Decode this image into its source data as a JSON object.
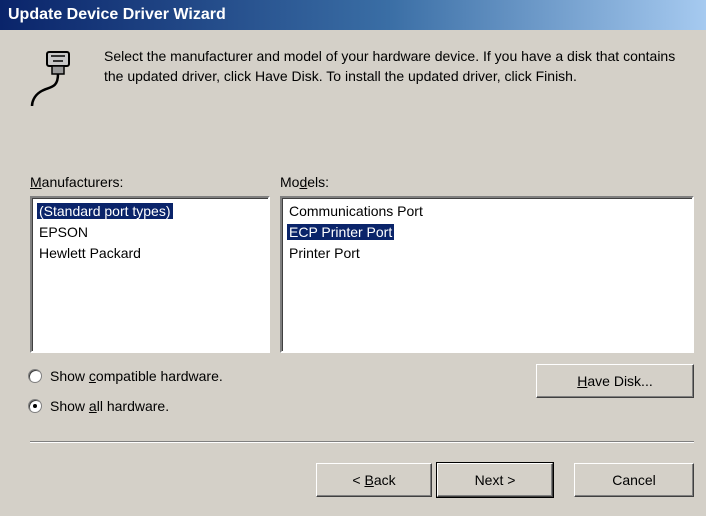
{
  "window": {
    "title": "Update Device Driver Wizard"
  },
  "instructions": "Select the manufacturer and model of your hardware device. If you have a disk that contains the updated driver, click Have Disk. To install the updated driver, click Finish.",
  "manufacturers": {
    "label_pre": "",
    "label_key": "M",
    "label_post": "anufacturers:",
    "items": [
      "(Standard port types)",
      "EPSON",
      "Hewlett Packard"
    ],
    "selected_index": 0
  },
  "models": {
    "label_pre": "Mo",
    "label_key": "d",
    "label_post": "els:",
    "items": [
      "Communications Port",
      "ECP Printer Port",
      "Printer Port"
    ],
    "selected_index": 1
  },
  "options": {
    "compatible": {
      "pre": "Show ",
      "key": "c",
      "post": "ompatible hardware.",
      "checked": false
    },
    "all": {
      "pre": "Show ",
      "key": "a",
      "post": "ll hardware.",
      "checked": true
    }
  },
  "buttons": {
    "have_disk": {
      "key": "H",
      "post": "ave Disk..."
    },
    "back": {
      "pre": "< ",
      "key": "B",
      "post": "ack"
    },
    "next": "Next >",
    "cancel": "Cancel"
  },
  "icon": "serial-port-connector-icon"
}
